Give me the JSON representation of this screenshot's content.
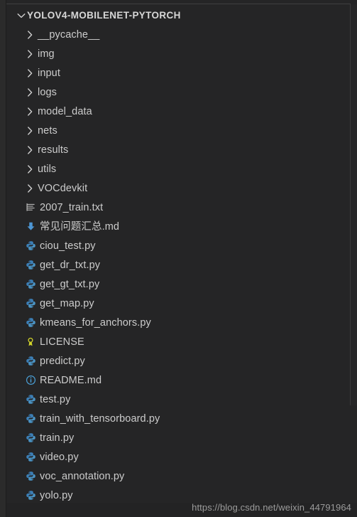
{
  "explorer": {
    "root": {
      "label": "YOLOV4-MOBILENET-PYTORCH",
      "expanded": true,
      "twisty": "chevron-down-icon"
    },
    "items": [
      {
        "label": "__pycache__",
        "kind": "folder",
        "icon": "chevron-right-icon"
      },
      {
        "label": "img",
        "kind": "folder",
        "icon": "chevron-right-icon"
      },
      {
        "label": "input",
        "kind": "folder",
        "icon": "chevron-right-icon"
      },
      {
        "label": "logs",
        "kind": "folder",
        "icon": "chevron-right-icon"
      },
      {
        "label": "model_data",
        "kind": "folder",
        "icon": "chevron-right-icon"
      },
      {
        "label": "nets",
        "kind": "folder",
        "icon": "chevron-right-icon"
      },
      {
        "label": "results",
        "kind": "folder",
        "icon": "chevron-right-icon"
      },
      {
        "label": "utils",
        "kind": "folder",
        "icon": "chevron-right-icon"
      },
      {
        "label": "VOCdevkit",
        "kind": "folder",
        "icon": "chevron-right-icon"
      },
      {
        "label": "2007_train.txt",
        "kind": "file",
        "icon": "text-lines-icon"
      },
      {
        "label": "常见问题汇总.md",
        "kind": "file",
        "icon": "markdown-arrow-icon"
      },
      {
        "label": "ciou_test.py",
        "kind": "file",
        "icon": "python-icon"
      },
      {
        "label": "get_dr_txt.py",
        "kind": "file",
        "icon": "python-icon"
      },
      {
        "label": "get_gt_txt.py",
        "kind": "file",
        "icon": "python-icon"
      },
      {
        "label": "get_map.py",
        "kind": "file",
        "icon": "python-icon"
      },
      {
        "label": "kmeans_for_anchors.py",
        "kind": "file",
        "icon": "python-icon"
      },
      {
        "label": "LICENSE",
        "kind": "file",
        "icon": "license-ribbon-icon"
      },
      {
        "label": "predict.py",
        "kind": "file",
        "icon": "python-icon"
      },
      {
        "label": "README.md",
        "kind": "file",
        "icon": "info-circle-icon"
      },
      {
        "label": "test.py",
        "kind": "file",
        "icon": "python-icon"
      },
      {
        "label": "train_with_tensorboard.py",
        "kind": "file",
        "icon": "python-icon"
      },
      {
        "label": "train.py",
        "kind": "file",
        "icon": "python-icon"
      },
      {
        "label": "video.py",
        "kind": "file",
        "icon": "python-icon"
      },
      {
        "label": "voc_annotation.py",
        "kind": "file",
        "icon": "python-icon"
      },
      {
        "label": "yolo.py",
        "kind": "file",
        "icon": "python-icon"
      }
    ]
  },
  "watermark": {
    "text": "https://blog.csdn.net/weixin_44791964"
  },
  "colors": {
    "background": "#252526",
    "text": "#cccccc",
    "python_icon": "#3b7db5",
    "txt_icon": "#c8c8c8",
    "md_icon": "#4d96d4",
    "license_icon": "#cfd12a",
    "info_icon": "#4a9ed4",
    "watermark": "#9b9b9b"
  }
}
